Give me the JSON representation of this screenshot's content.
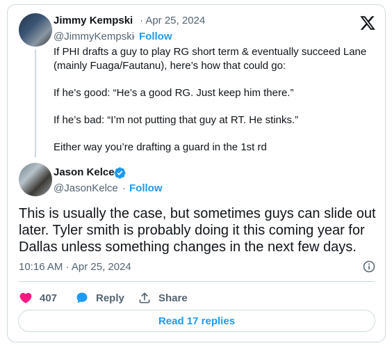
{
  "quoted": {
    "author_name": "Jimmy Kempski",
    "date": "· Apr 25, 2024",
    "handle": "@JimmyKempski",
    "separator": "·",
    "follow_label": "Follow",
    "paragraphs": [
      "If PHI drafts a guy to play RG short term & eventually succeed Lane (mainly Fuaga/Fautanu), here’s how that could go:",
      "If he’s good: “He’s a good RG. Just keep him there.”",
      "If he’s bad: “I’m not putting that guy at RT. He stinks.”",
      "Either way you’re drafting a guard in the 1st rd"
    ]
  },
  "reply": {
    "author_name": "Jason Kelce",
    "handle": "@JasonKelce",
    "separator": "·",
    "follow_label": "Follow",
    "text": "This is usually the case, but sometimes guys can slide out later.  Tyler smith is probably doing it this coming year for Dallas unless something changes in the next few days.",
    "timestamp": "10:16 AM · Apr 25, 2024"
  },
  "actions": {
    "like_count": "407",
    "reply_label": "Reply",
    "share_label": "Share"
  },
  "read_replies_label": "Read 17 replies",
  "icons": {
    "logo": "x-logo-icon",
    "verified": "verified-badge-icon",
    "info": "info-icon",
    "like": "heart-icon",
    "reply": "reply-bubble-icon",
    "share": "share-icon"
  },
  "colors": {
    "accent": "#1d9bf0",
    "like": "#f91880",
    "text": "#0f1419",
    "muted": "#536471",
    "border": "#cfd9de"
  }
}
